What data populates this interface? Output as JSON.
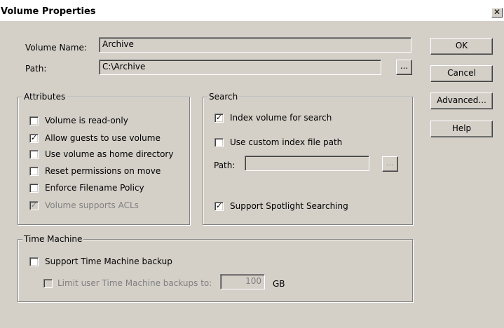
{
  "window": {
    "title": "Volume Properties",
    "close_glyph": "✕"
  },
  "general": {
    "volume_name_label": "Volume Name:",
    "volume_name_value": "Archive",
    "path_label": "Path:",
    "path_value": "C:\\Archive",
    "browse_label": "..."
  },
  "buttons": {
    "ok": "OK",
    "cancel": "Cancel",
    "advanced": "Advanced...",
    "help": "Help"
  },
  "attributes": {
    "title": "Attributes",
    "items": [
      {
        "label": "Volume is read-only",
        "checked": false,
        "disabled": false
      },
      {
        "label": "Allow guests to use volume",
        "checked": true,
        "disabled": false
      },
      {
        "label": "Use volume as home directory",
        "checked": false,
        "disabled": false
      },
      {
        "label": "Reset permissions on move",
        "checked": false,
        "disabled": false
      },
      {
        "label": "Enforce Filename Policy",
        "checked": false,
        "disabled": false
      },
      {
        "label": "Volume supports ACLs",
        "checked": true,
        "disabled": true
      }
    ]
  },
  "search": {
    "title": "Search",
    "index_label": "Index volume for search",
    "index_checked": true,
    "custom_path_label": "Use custom index file path",
    "custom_path_checked": false,
    "path_label": "Path:",
    "path_value": "",
    "browse_label": "...",
    "spotlight_label": "Support Spotlight Searching",
    "spotlight_checked": true
  },
  "time_machine": {
    "title": "Time Machine",
    "support_label": "Support Time Machine backup",
    "support_checked": false,
    "limit_label": "Limit user Time Machine backups to:",
    "limit_checked": false,
    "limit_value": "100",
    "limit_unit": "GB"
  },
  "glyphs": {
    "check": "✓"
  }
}
